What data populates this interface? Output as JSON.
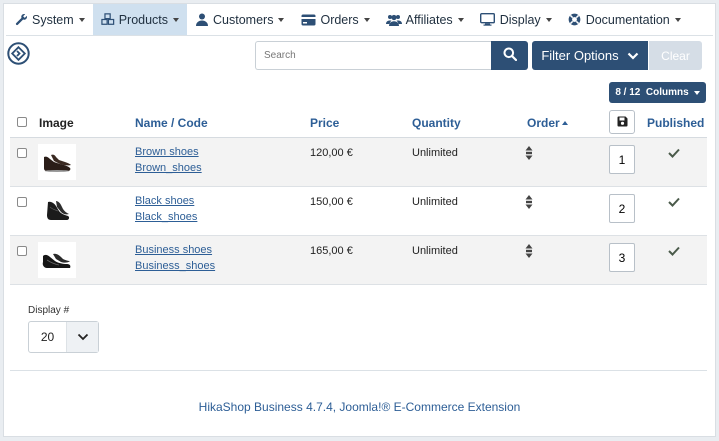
{
  "menu": [
    {
      "label": "System",
      "icon": "wrench-icon"
    },
    {
      "label": "Products",
      "icon": "cubes-icon",
      "active": true
    },
    {
      "label": "Customers",
      "icon": "user-icon"
    },
    {
      "label": "Orders",
      "icon": "credit-card-icon"
    },
    {
      "label": "Affiliates",
      "icon": "users-icon"
    },
    {
      "label": "Display",
      "icon": "monitor-icon"
    },
    {
      "label": "Documentation",
      "icon": "lifebuoy-icon"
    }
  ],
  "toolbar": {
    "search_placeholder": "Search",
    "filter_label": "Filter Options",
    "clear_label": "Clear",
    "columns_label": "8 / 12  Columns"
  },
  "table": {
    "headers": {
      "image": "Image",
      "name": "Name / Code",
      "price": "Price",
      "quantity": "Quantity",
      "order": "Order",
      "published": "Published"
    },
    "rows": [
      {
        "name": "Brown shoes",
        "code": "Brown_shoes",
        "price": "120,00 €",
        "quantity": "Unlimited",
        "order": "1",
        "published": true
      },
      {
        "name": "Black shoes",
        "code": "Black_shoes",
        "price": "150,00 €",
        "quantity": "Unlimited",
        "order": "2",
        "published": true
      },
      {
        "name": "Business shoes",
        "code": "Business_shoes",
        "price": "165,00 €",
        "quantity": "Unlimited",
        "order": "3",
        "published": true
      }
    ]
  },
  "pagination": {
    "display_label": "Display #",
    "display_value": "20"
  },
  "footer": {
    "text": "HikaShop Business 4.7.4, Joomla!® E-Commerce Extension"
  },
  "colors": {
    "primary": "#2d4f75",
    "link": "#2d5e96",
    "active_menu": "#cfe0ef",
    "check": "#4a5a4a"
  }
}
